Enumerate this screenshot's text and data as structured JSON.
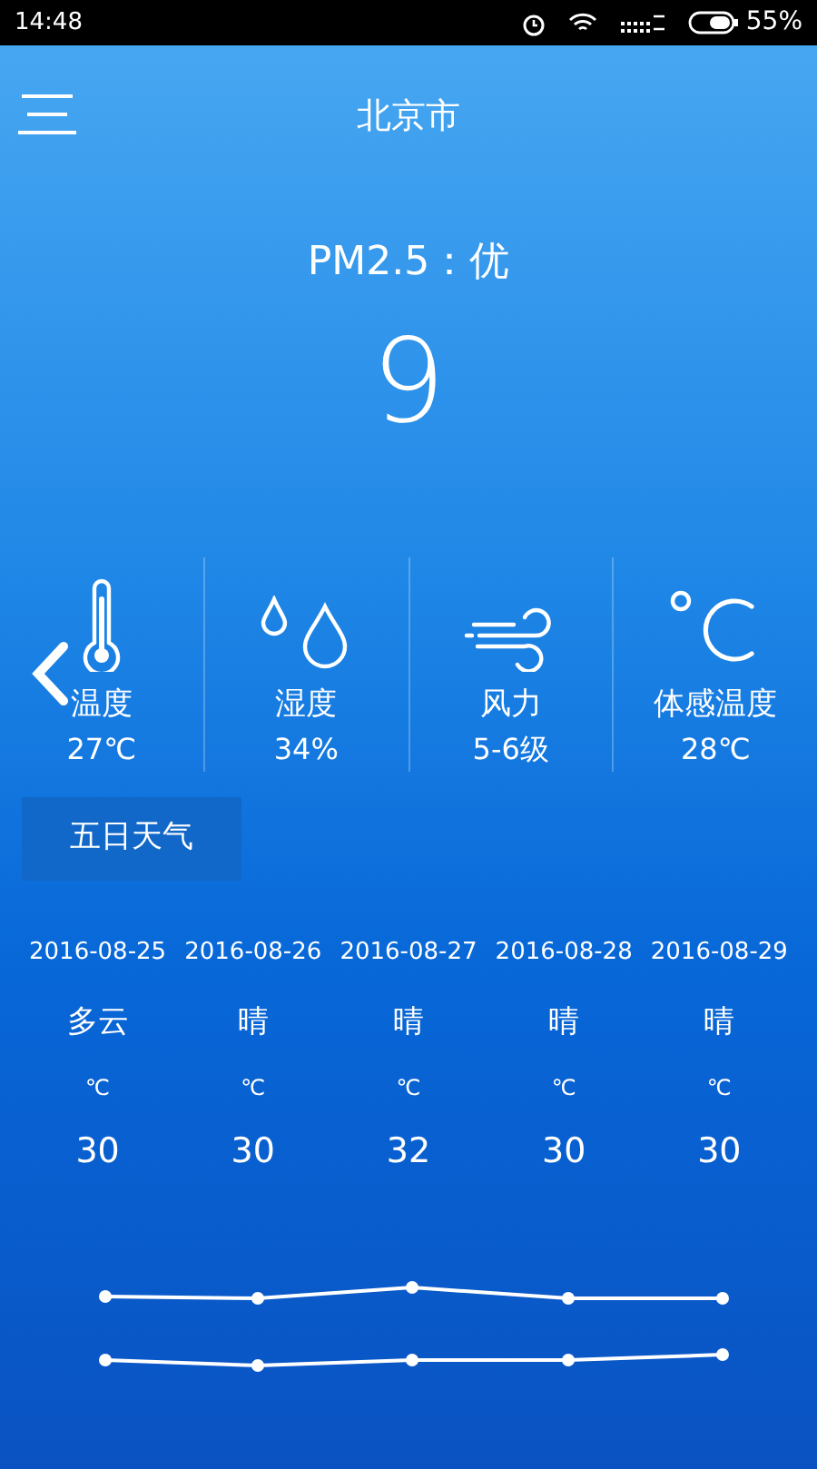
{
  "status_bar": {
    "time": "14:48",
    "battery": "55%"
  },
  "header": {
    "title": "北京市"
  },
  "air": {
    "label": "PM2.5：优",
    "value": "9"
  },
  "metrics": [
    {
      "kind": "thermometer",
      "label": "温度",
      "value": "27℃"
    },
    {
      "kind": "drops",
      "label": "湿度",
      "value": "34%"
    },
    {
      "kind": "wind",
      "label": "风力",
      "value": "5-6级"
    },
    {
      "kind": "celsius",
      "label": "体感温度",
      "value": "28℃"
    }
  ],
  "tab": {
    "label": "五日天气"
  },
  "forecast": [
    {
      "date": "2016-08-25",
      "weather": "多云",
      "unit": "℃",
      "temp": "30"
    },
    {
      "date": "2016-08-26",
      "weather": "晴",
      "unit": "℃",
      "temp": "30"
    },
    {
      "date": "2016-08-27",
      "weather": "晴",
      "unit": "℃",
      "temp": "32"
    },
    {
      "date": "2016-08-28",
      "weather": "晴",
      "unit": "℃",
      "temp": "30"
    },
    {
      "date": "2016-08-29",
      "weather": "晴",
      "unit": "℃",
      "temp": "30"
    }
  ]
}
